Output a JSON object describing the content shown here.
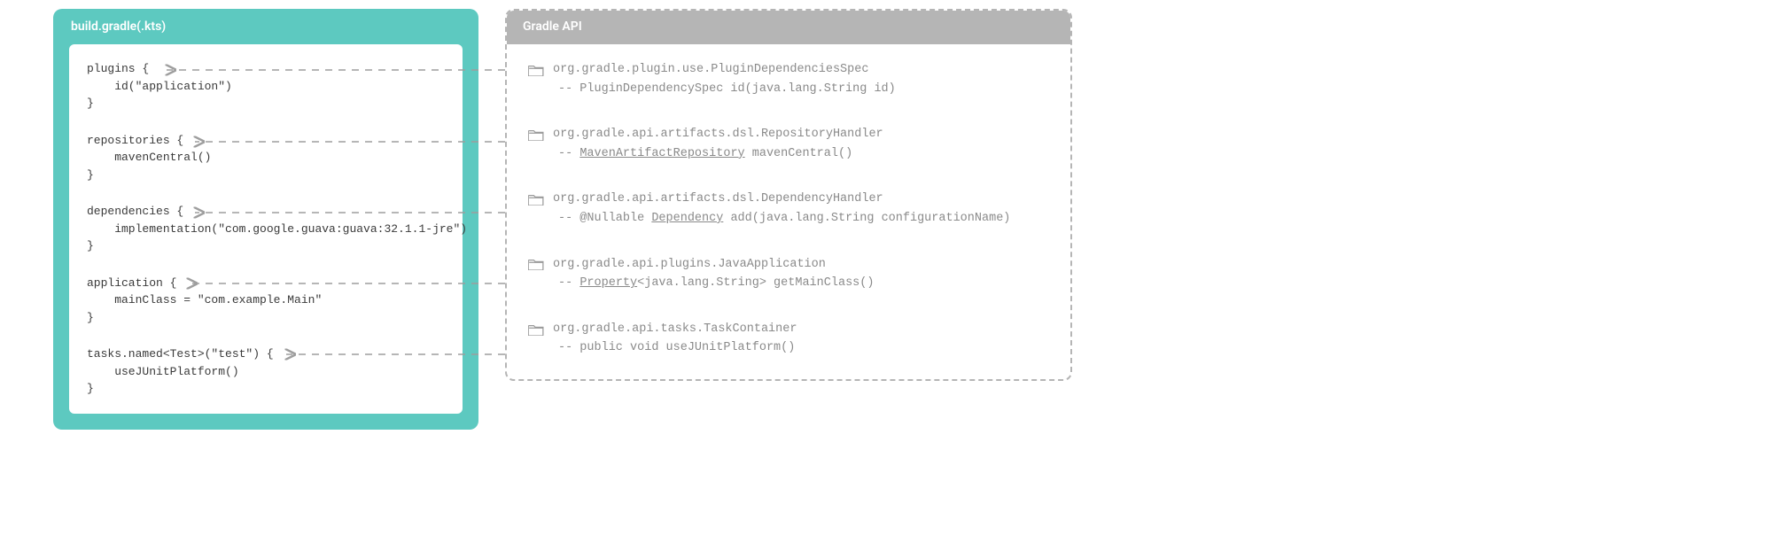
{
  "left": {
    "title": "build.gradle(.kts)",
    "blocks": [
      "plugins {\n    id(\"application\")\n}",
      "repositories {\n    mavenCentral()\n}",
      "dependencies {\n    implementation(\"com.google.guava:guava:32.1.1-jre\")\n}",
      "application {\n    mainClass = \"com.example.Main\"\n}",
      "tasks.named<Test>(\"test\") {\n    useJUnitPlatform()\n}"
    ]
  },
  "right": {
    "title": "Gradle API",
    "items": [
      {
        "class": "org.gradle.plugin.use.PluginDependenciesSpec",
        "detail_prefix": "-- PluginDependencySpec id(java.lang.String id)",
        "link": "",
        "detail_suffix": ""
      },
      {
        "class": "org.gradle.api.artifacts.dsl.RepositoryHandler",
        "detail_prefix": "-- ",
        "link": "MavenArtifactRepository",
        "detail_suffix": " mavenCentral()"
      },
      {
        "class": "org.gradle.api.artifacts.dsl.DependencyHandler",
        "detail_prefix": "-- @Nullable ",
        "link": "Dependency",
        "detail_suffix": " add(java.lang.String configurationName)"
      },
      {
        "class": "org.gradle.api.plugins.JavaApplication",
        "detail_prefix": "-- ",
        "link": "Property",
        "detail_suffix": "<java.lang.String> getMainClass()"
      },
      {
        "class": "org.gradle.api.tasks.TaskContainer",
        "detail_prefix": "-- public void useJUnitPlatform()",
        "link": "",
        "detail_suffix": ""
      }
    ]
  }
}
